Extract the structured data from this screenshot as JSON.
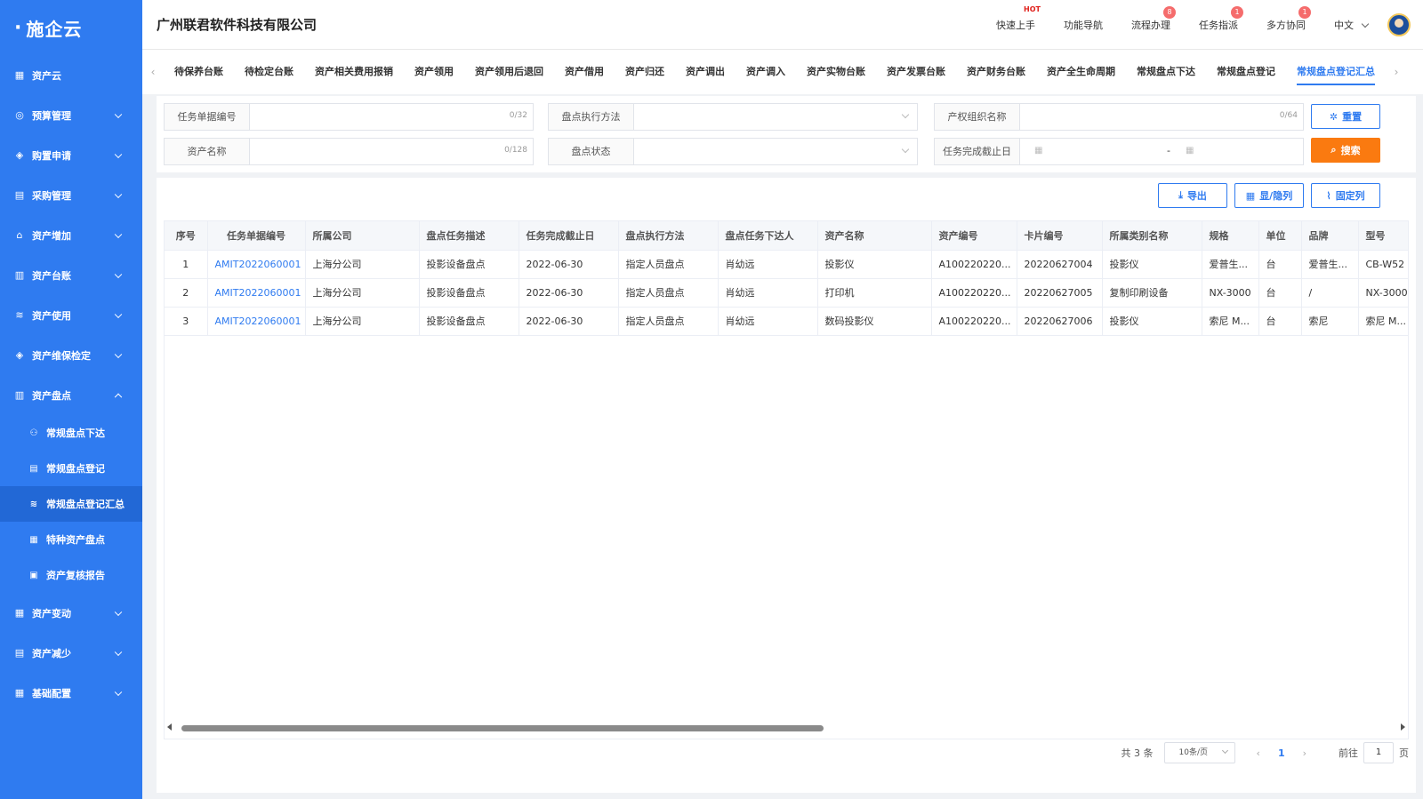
{
  "app": {
    "logo": "施企云",
    "company": "广州联君软件科技有限公司"
  },
  "header": {
    "nav": [
      {
        "label": "快速上手",
        "hot": "HOT"
      },
      {
        "label": "功能导航"
      },
      {
        "label": "流程办理",
        "badge": "8"
      },
      {
        "label": "任务指派",
        "badge": "1"
      },
      {
        "label": "多方协同",
        "badge": "1"
      }
    ],
    "lang": "中文"
  },
  "sidebar": {
    "items": [
      {
        "label": "资产云",
        "icon": "grid-icon"
      },
      {
        "label": "预算管理",
        "icon": "coins-icon"
      },
      {
        "label": "购置申请",
        "icon": "cube-icon"
      },
      {
        "label": "采购管理",
        "icon": "clipboard-icon"
      },
      {
        "label": "资产增加",
        "icon": "home-icon"
      },
      {
        "label": "资产台账",
        "icon": "ledger-icon"
      },
      {
        "label": "资产使用",
        "icon": "layers-icon"
      },
      {
        "label": "资产维保检定",
        "icon": "cube-icon"
      },
      {
        "label": "资产盘点",
        "icon": "ledger-icon"
      },
      {
        "label": "资产变动",
        "icon": "grid-icon"
      },
      {
        "label": "资产减少",
        "icon": "clipboard-icon"
      },
      {
        "label": "基础配置",
        "icon": "grid-icon"
      }
    ],
    "sub": [
      "常规盘点下达",
      "常规盘点登记",
      "常规盘点登记汇总",
      "特种资产盘点",
      "资产复核报告"
    ]
  },
  "tabs": [
    "待保养台账",
    "待检定台账",
    "资产相关费用报销",
    "资产领用",
    "资产领用后退回",
    "资产借用",
    "资产归还",
    "资产调出",
    "资产调入",
    "资产实物台账",
    "资产发票台账",
    "资产财务台账",
    "资产全生命周期",
    "常规盘点下达",
    "常规盘点登记",
    "常规盘点登记汇总"
  ],
  "filters": {
    "task_no": {
      "label": "任务单据编号",
      "count": "0/32"
    },
    "method": {
      "label": "盘点执行方法"
    },
    "org": {
      "label": "产权组织名称",
      "count": "0/64"
    },
    "asset_name": {
      "label": "资产名称",
      "count": "0/128"
    },
    "status": {
      "label": "盘点状态"
    },
    "deadline": {
      "label": "任务完成截止日",
      "sep": "-"
    }
  },
  "buttons": {
    "reset": "重置",
    "search": "搜索",
    "export": "导出",
    "toggle_cols": "显/隐列",
    "fix_cols": "固定列"
  },
  "table": {
    "headers": [
      "序号",
      "任务单据编号",
      "所属公司",
      "盘点任务描述",
      "任务完成截止日",
      "盘点执行方法",
      "盘点任务下达人",
      "资产名称",
      "资产编号",
      "卡片编号",
      "所属类别名称",
      "规格",
      "单位",
      "品牌",
      "型号"
    ],
    "rows": [
      [
        "1",
        "AMIT2022060001",
        "上海分公司",
        "投影设备盘点",
        "2022-06-30",
        "指定人员盘点",
        "肖幼远",
        "投影仪",
        "A100220220...",
        "20220627004",
        "投影仪",
        "爱普生...",
        "台",
        "爱普生...",
        "CB-W52"
      ],
      [
        "2",
        "AMIT2022060001",
        "上海分公司",
        "投影设备盘点",
        "2022-06-30",
        "指定人员盘点",
        "肖幼远",
        "打印机",
        "A100220220...",
        "20220627005",
        "复制印刷设备",
        "NX-3000",
        "台",
        "/",
        "NX-3000"
      ],
      [
        "3",
        "AMIT2022060001",
        "上海分公司",
        "投影设备盘点",
        "2022-06-30",
        "指定人员盘点",
        "肖幼远",
        "数码投影仪",
        "A100220220...",
        "20220627006",
        "投影仪",
        "索尼 M...",
        "台",
        "索尼",
        "索尼 M..."
      ]
    ]
  },
  "pager": {
    "total": "共 3 条",
    "page_size": "10条/页",
    "current": "1",
    "goto_label": "前往",
    "goto_value": "1",
    "page_unit": "页"
  }
}
